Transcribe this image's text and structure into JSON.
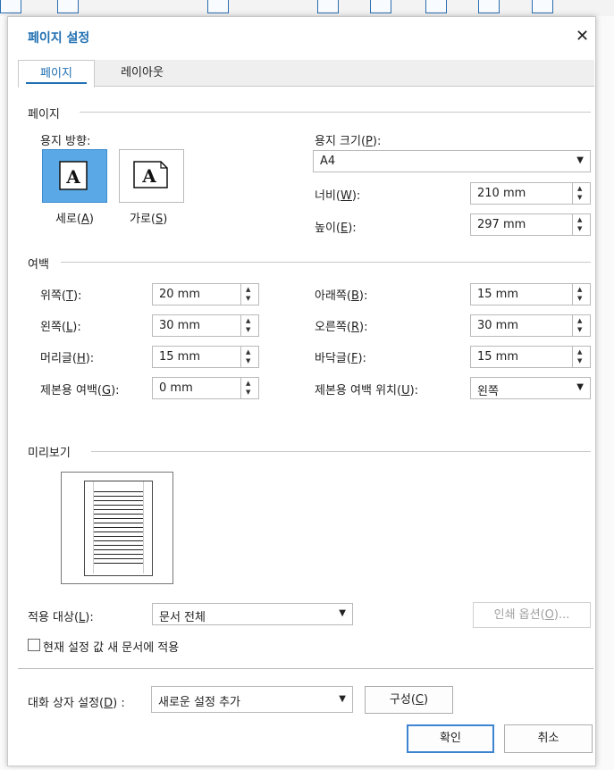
{
  "dialog": {
    "title": "페이지 설정"
  },
  "tabs": [
    "페이지",
    "레이아웃"
  ],
  "page_section": {
    "title": "페이지",
    "orientation_label": "용지 방향:",
    "portrait_label": "세로(",
    "portrait_key": "A",
    "landscape_label": "가로(",
    "landscape_key": "S",
    "icon_letter": "A",
    "paper_size_label": "용지 크기(",
    "paper_size_key": "P",
    "paper_size_value": "A4",
    "width_label": "너비(",
    "width_key": "W",
    "width_value": "210 mm",
    "height_label": "높이(",
    "height_key": "E",
    "height_value": "297 mm"
  },
  "margins": {
    "title": "여백",
    "top_label": "위쪽(",
    "top_key": "T",
    "top_value": "20 mm",
    "left_label": "왼쪽(",
    "left_key": "L",
    "left_value": "30 mm",
    "header_label": "머리글(",
    "header_key": "H",
    "header_value": "15 mm",
    "gutter_label": "제본용 여백(",
    "gutter_key": "G",
    "gutter_value": "0 mm",
    "bottom_label": "아래쪽(",
    "bottom_key": "B",
    "bottom_value": "15 mm",
    "right_label": "오른쪽(",
    "right_key": "R",
    "right_value": "30 mm",
    "footer_label": "바닥글(",
    "footer_key": "F",
    "footer_value": "15 mm",
    "gutter_pos_label": "제본용 여백 위치(",
    "gutter_pos_key": "U",
    "gutter_pos_value": "왼쪽"
  },
  "preview": {
    "title": "미리보기"
  },
  "apply": {
    "label": "적용 대상(",
    "key": "L",
    "value": "문서 전체",
    "print_options": "인쇄 옵션(",
    "print_options_key": "O",
    "checkbox_label": "현재 설정 값 새 문서에 적용"
  },
  "footer": {
    "preset_label": "대화 상자 설정(",
    "preset_key": "D",
    "preset_value": "새로운 설정 추가",
    "configure": "구성(",
    "configure_key": "C",
    "ok": "확인",
    "cancel": "취소"
  }
}
